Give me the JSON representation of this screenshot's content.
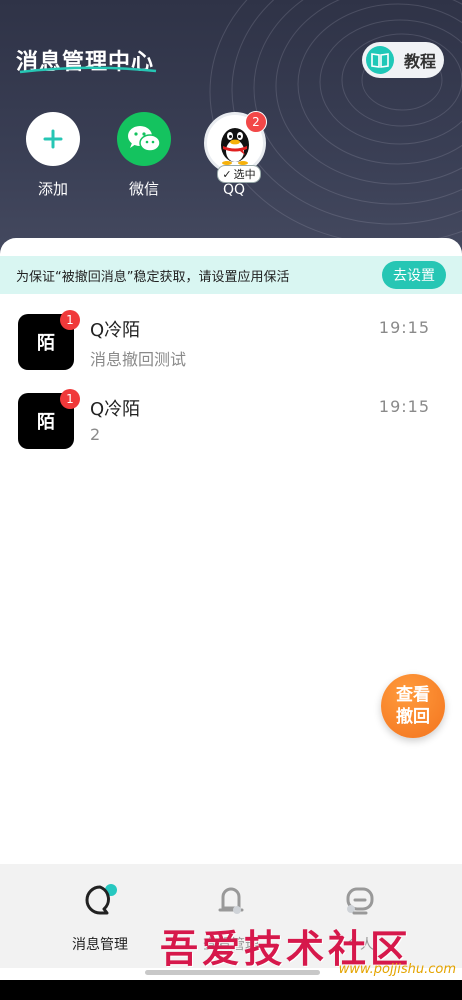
{
  "header": {
    "title": "消息管理中心",
    "tutorial_label": "教程",
    "apps": [
      {
        "label": "添加",
        "icon": "plus-icon"
      },
      {
        "label": "微信",
        "icon": "wechat-icon"
      },
      {
        "label": "QQ",
        "icon": "qq-penguin-icon",
        "badge": "2",
        "selected_label": "选中"
      }
    ]
  },
  "notice": {
    "text": "为保证“被撤回消息”稳定获取，请设置应用保活",
    "button_label": "去设置"
  },
  "messages": [
    {
      "avatar_text": "陌",
      "badge": "1",
      "name": "Q冷陌",
      "preview": "消息撤回测试",
      "time": "19:15"
    },
    {
      "avatar_text": "陌",
      "badge": "1",
      "name": "Q冷陌",
      "preview": "2",
      "time": "19:15"
    }
  ],
  "fab": {
    "line1": "查看",
    "line2": "撤回"
  },
  "bottom_nav": {
    "items": [
      {
        "label": "消息管理",
        "icon": "chat-bubble-icon",
        "active": true
      },
      {
        "label": "查看管理",
        "icon": "bell-icon",
        "active": false
      },
      {
        "label": "个人",
        "icon": "robot-face-icon",
        "active": false
      }
    ]
  },
  "watermark": {
    "text": "吾爱技术社区",
    "url": "www.pojjishu.com"
  },
  "colors": {
    "header_bg": "#353a4f",
    "accent_teal": "#26c6b4",
    "badge_red": "#f0393a",
    "fab_orange": "#f3741f",
    "wechat_green": "#14c35f"
  }
}
